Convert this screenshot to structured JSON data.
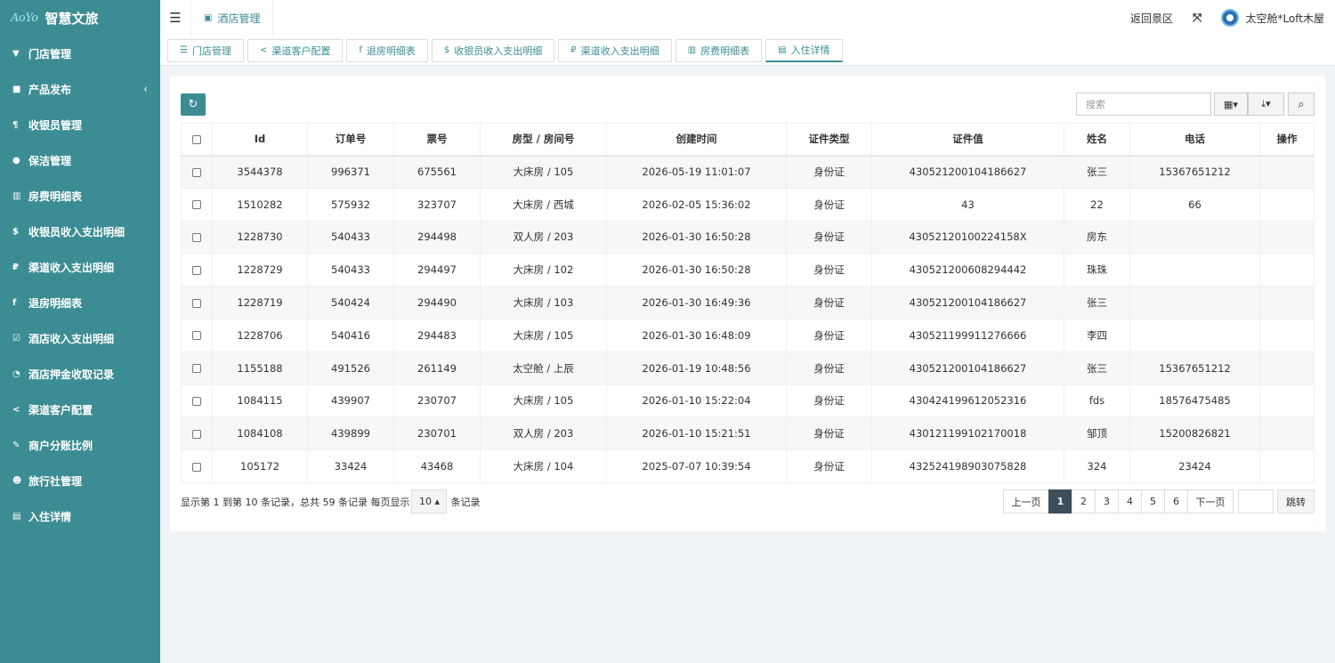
{
  "brand": {
    "logo_text": "AoYo",
    "name": "智慧文旅"
  },
  "sidebar": {
    "items": [
      {
        "label": "门店管理",
        "icon": "filter-icon",
        "glyph": "▼"
      },
      {
        "label": "产品发布",
        "icon": "square-icon",
        "glyph": "■"
      },
      {
        "label": "收银员管理",
        "icon": "paragraph-icon",
        "glyph": "¶"
      },
      {
        "label": "保洁管理",
        "icon": "user-icon",
        "glyph": "●"
      },
      {
        "label": "房费明细表",
        "icon": "bar-chart-icon",
        "glyph": "▥"
      },
      {
        "label": "收银员收入支出明细",
        "icon": "dollar-icon",
        "glyph": "$"
      },
      {
        "label": "渠道收入支出明细",
        "icon": "ruble-icon",
        "glyph": "₽"
      },
      {
        "label": "退房明细表",
        "icon": "facebook-icon",
        "glyph": "f"
      },
      {
        "label": "酒店收入支出明细",
        "icon": "check-square-icon",
        "glyph": "☑"
      },
      {
        "label": "酒店押金收取记录",
        "icon": "clock-icon",
        "glyph": "◔"
      },
      {
        "label": "渠道客户配置",
        "icon": "share-icon",
        "glyph": "<"
      },
      {
        "label": "商户分账比例",
        "icon": "pen-icon",
        "glyph": "✎"
      },
      {
        "label": "旅行社管理",
        "icon": "users-icon",
        "glyph": "☻"
      },
      {
        "label": "入住详情",
        "icon": "html5-icon",
        "glyph": "▤"
      }
    ]
  },
  "header": {
    "menu_glyph": "☰",
    "tab": {
      "label": "酒店管理",
      "glyph": "▣"
    },
    "back_label": "返回景区",
    "fullscreen_glyph": "⤧",
    "username": "太空舱*Loft木屋"
  },
  "subtabs": [
    {
      "label": "门店管理",
      "glyph": "☰",
      "active": false
    },
    {
      "label": "渠道客户配置",
      "glyph": "<",
      "active": false
    },
    {
      "label": "退房明细表",
      "glyph": "f",
      "active": false
    },
    {
      "label": "收银员收入支出明细",
      "glyph": "$",
      "active": false
    },
    {
      "label": "渠道收入支出明细",
      "glyph": "₽",
      "active": false
    },
    {
      "label": "房费明细表",
      "glyph": "▥",
      "active": false
    },
    {
      "label": "入住详情",
      "glyph": "▤",
      "active": true
    }
  ],
  "toolbar": {
    "refresh_glyph": "↻",
    "search_placeholder": "搜索",
    "columns_glyph": "▦▾",
    "export_glyph": "⤓▾",
    "search_glyph": "⌕"
  },
  "table": {
    "headers": [
      "Id",
      "订单号",
      "票号",
      "房型 / 房间号",
      "创建时间",
      "证件类型",
      "证件值",
      "姓名",
      "电话",
      "操作"
    ],
    "rows": [
      [
        "3544378",
        "996371",
        "675561",
        "大床房 / 105",
        "2026-05-19 11:01:07",
        "身份证",
        "430521200104186627",
        "张三",
        "15367651212",
        ""
      ],
      [
        "1510282",
        "575932",
        "323707",
        "大床房 / 西城",
        "2026-02-05 15:36:02",
        "身份证",
        "43",
        "22",
        "66",
        ""
      ],
      [
        "1228730",
        "540433",
        "294498",
        "双人房 / 203",
        "2026-01-30 16:50:28",
        "身份证",
        "43052120100224158X",
        "房东",
        "",
        ""
      ],
      [
        "1228729",
        "540433",
        "294497",
        "大床房 / 102",
        "2026-01-30 16:50:28",
        "身份证",
        "430521200608294442",
        "珠珠",
        "",
        ""
      ],
      [
        "1228719",
        "540424",
        "294490",
        "大床房 / 103",
        "2026-01-30 16:49:36",
        "身份证",
        "430521200104186627",
        "张三",
        "",
        ""
      ],
      [
        "1228706",
        "540416",
        "294483",
        "大床房 / 105",
        "2026-01-30 16:48:09",
        "身份证",
        "430521199911276666",
        "李四",
        "",
        ""
      ],
      [
        "1155188",
        "491526",
        "261149",
        "太空舱 / 上辰",
        "2026-01-19 10:48:56",
        "身份证",
        "430521200104186627",
        "张三",
        "15367651212",
        ""
      ],
      [
        "1084115",
        "439907",
        "230707",
        "大床房 / 105",
        "2026-01-10 15:22:04",
        "身份证",
        "430424199612052316",
        "fds",
        "18576475485",
        ""
      ],
      [
        "1084108",
        "439899",
        "230701",
        "双人房 / 203",
        "2026-01-10 15:21:51",
        "身份证",
        "430121199102170018",
        "邹顶",
        "15200826821",
        ""
      ],
      [
        "105172",
        "33424",
        "43468",
        "大床房 / 104",
        "2025-07-07 10:39:54",
        "身份证",
        "432524198903075828",
        "324",
        "23424",
        ""
      ]
    ]
  },
  "pager": {
    "summary": "显示第 1 到第 10 条记录，总共 59 条记录 每页显示",
    "page_size": "10 ▴",
    "suffix": "条记录",
    "prev": "上一页",
    "pages": [
      "1",
      "2",
      "3",
      "4",
      "5",
      "6"
    ],
    "current": "1",
    "next": "下一页",
    "jump": "跳转"
  }
}
